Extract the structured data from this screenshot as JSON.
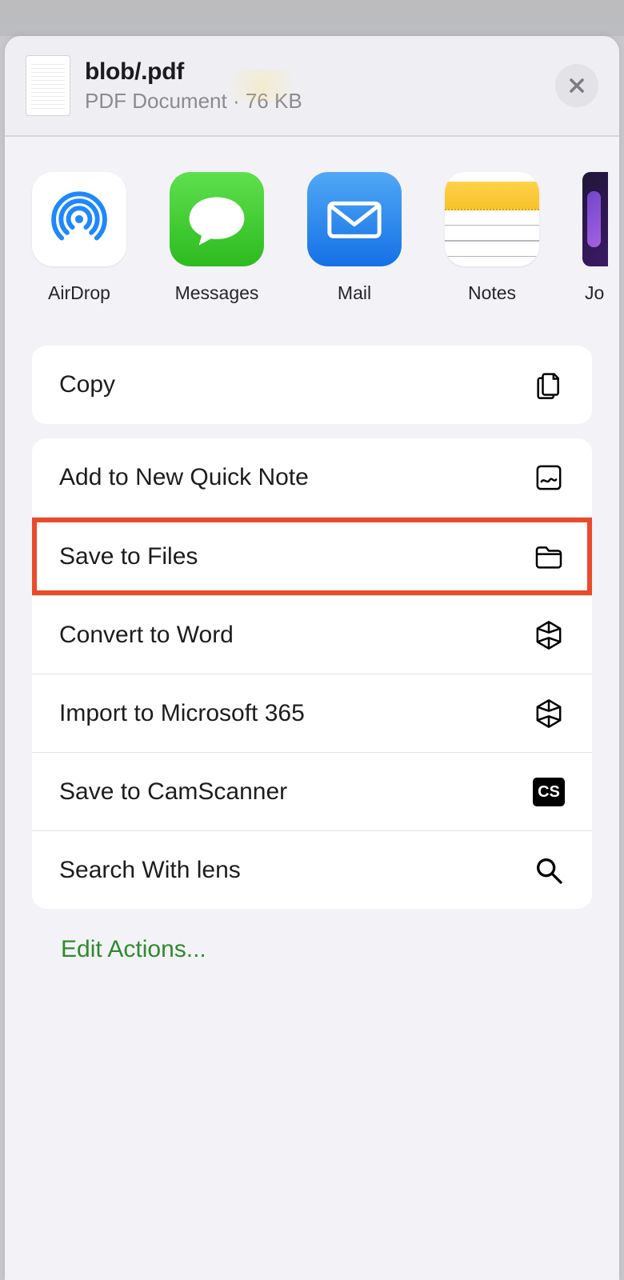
{
  "header": {
    "title": "blob/.pdf",
    "subtitle": "PDF Document · 76 KB"
  },
  "apps": {
    "airdrop": "AirDrop",
    "messages": "Messages",
    "mail": "Mail",
    "notes": "Notes",
    "journal": "Jo"
  },
  "actions": {
    "copy": "Copy",
    "quicknote": "Add to New Quick Note",
    "savefiles": "Save to Files",
    "convertword": "Convert to Word",
    "import365": "Import to Microsoft 365",
    "camscanner": "Save to CamScanner",
    "searchlens": "Search With lens"
  },
  "edit_actions": "Edit Actions...",
  "highlighted_action": "savefiles",
  "colors": {
    "highlight": "#ea4a2b",
    "link": "#2f8a2e"
  }
}
